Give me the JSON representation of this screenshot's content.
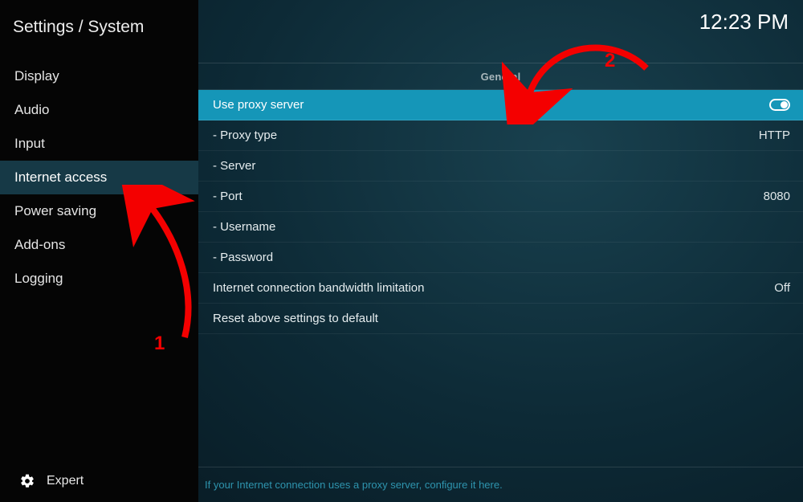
{
  "breadcrumb": "Settings / System",
  "clock": "12:23 PM",
  "sidebar": {
    "items": [
      {
        "label": "Display",
        "selected": false
      },
      {
        "label": "Audio",
        "selected": false
      },
      {
        "label": "Input",
        "selected": false
      },
      {
        "label": "Internet access",
        "selected": true
      },
      {
        "label": "Power saving",
        "selected": false
      },
      {
        "label": "Add-ons",
        "selected": false
      },
      {
        "label": "Logging",
        "selected": false
      }
    ],
    "level_label": "Expert"
  },
  "section_header": "General",
  "settings": [
    {
      "label": "Use proxy server",
      "value": "",
      "toggle": true,
      "highlight": true,
      "sub": false
    },
    {
      "label": "Proxy type",
      "value": "HTTP",
      "sub": true
    },
    {
      "label": "Server",
      "value": "",
      "sub": true
    },
    {
      "label": "Port",
      "value": "8080",
      "sub": true
    },
    {
      "label": "Username",
      "value": "",
      "sub": true
    },
    {
      "label": "Password",
      "value": "",
      "sub": true
    },
    {
      "label": "Internet connection bandwidth limitation",
      "value": "Off",
      "sub": false
    },
    {
      "label": "Reset above settings to default",
      "value": "",
      "sub": false
    }
  ],
  "footer_hint": "If your Internet connection uses a proxy server, configure it here.",
  "annotations": {
    "one": "1",
    "two": "2"
  }
}
